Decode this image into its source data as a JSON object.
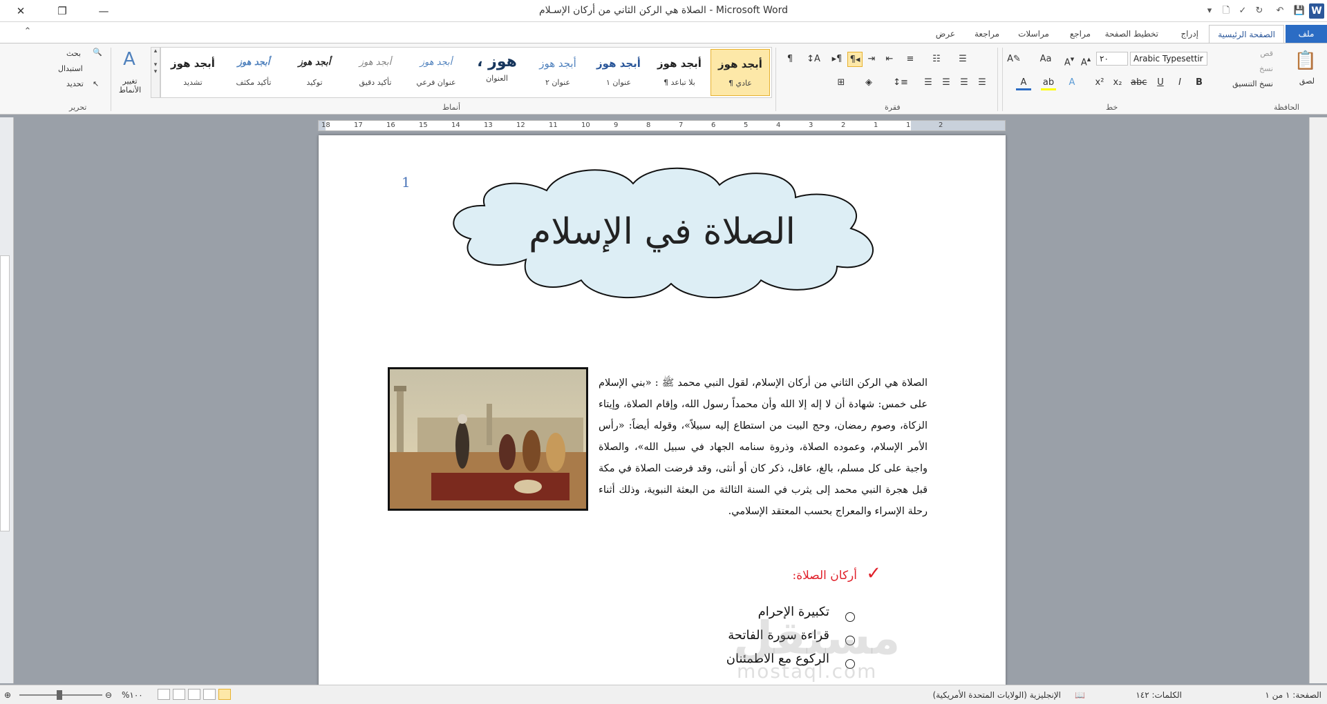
{
  "window": {
    "title": "الصلاة هي الركن الثاني من أركان الإسـلام - Microsoft Word",
    "minimize": "—",
    "restore": "❐",
    "close": "✕"
  },
  "tabs": [
    {
      "label": "ملف"
    },
    {
      "label": "الصفحة الرئيسية"
    },
    {
      "label": "إدراج"
    },
    {
      "label": "تخطيط الصفحة"
    },
    {
      "label": "مراجع"
    },
    {
      "label": "مراسلات"
    },
    {
      "label": "مراجعة"
    },
    {
      "label": "عرض"
    }
  ],
  "ribbon": {
    "clipboard": {
      "group": "الحافظة",
      "paste": "لصق",
      "cut": "قص",
      "copy": "نسخ",
      "format_painter": "نسخ التنسيق"
    },
    "font": {
      "group": "خط",
      "font_name": "Arabic Typesettir",
      "font_size": "٢٠"
    },
    "paragraph": {
      "group": "فقرة"
    },
    "styles": {
      "group": "أنماط",
      "change_styles": "تغيير الأنماط",
      "items": [
        {
          "sample": "أبجد هوز",
          "name": "¶ عادي"
        },
        {
          "sample": "أبجد هوز",
          "name": "¶ بلا تباعد"
        },
        {
          "sample": "أبجد هوز",
          "name": "عنوان ١"
        },
        {
          "sample": "أبجد هوز",
          "name": "عنوان ٢"
        },
        {
          "sample": "، هوز",
          "name": "العنوان"
        },
        {
          "sample": "أبجد هوز",
          "name": "عنوان فرعي"
        },
        {
          "sample": "أبجد هوز",
          "name": "تأكيد دقيق"
        },
        {
          "sample": "أبجد هوز",
          "name": "توكيد"
        },
        {
          "sample": "أبجد هوز",
          "name": "تأكيد مكثف"
        },
        {
          "sample": "أبجد هوز",
          "name": "تشديد"
        }
      ]
    },
    "editing": {
      "group": "تحرير",
      "find": "بحث",
      "replace": "استبدال",
      "select": "تحديد"
    }
  },
  "ruler": {
    "numbers": [
      "18",
      "17",
      "16",
      "15",
      "14",
      "13",
      "12",
      "11",
      "10",
      "9",
      "8",
      "7",
      "6",
      "5",
      "4",
      "3",
      "2",
      "1",
      "1",
      "2"
    ]
  },
  "document": {
    "page_number": "1",
    "title": "الصلاة في الإسلام",
    "paragraph": "الصلاة هي الركن الثاني من أركان الإسلام، لقول النبي محمد ﷺ : «بني الإسلام على خمس: شهادة أن لا إله إلا الله وأن محمداً رسول الله، وإقام الصلاة، وإيتاء الزكاة، وصوم رمضان، وحج البيت من استطاع إليه سبيلاً»، وقوله أيضاً: «رأس الأمر الإسلام، وعموده الصلاة، وذروة سنامه الجهاد في سبيل الله»، والصلاة واجبة على كل مسلم، بالغ، عاقل، ذكر كان أو أنثى، وقد فرضت الصلاة في مكة قبل هجرة النبي محمد إلى يثرب في السنة الثالثة من البعثة النبوية، وذلك أثناء رحلة الإسراء والمعراج بحسب المعتقد الإسلامي.",
    "list_heading": "أركان الصلاة:",
    "list_items": [
      "تكبيرة الإحرام",
      "قراءة سورة الفاتحة",
      "الركوع مع الاطمئنان"
    ],
    "watermark": "مستقل",
    "watermark_sub": "mostaql.com"
  },
  "statusbar": {
    "page": "الصفحة: ١ من ١",
    "words": "الكلمات: ١٤٢",
    "language": "الإنجليزية (الولايات المتحدة الأمريكية)",
    "zoom": "%١٠٠"
  }
}
